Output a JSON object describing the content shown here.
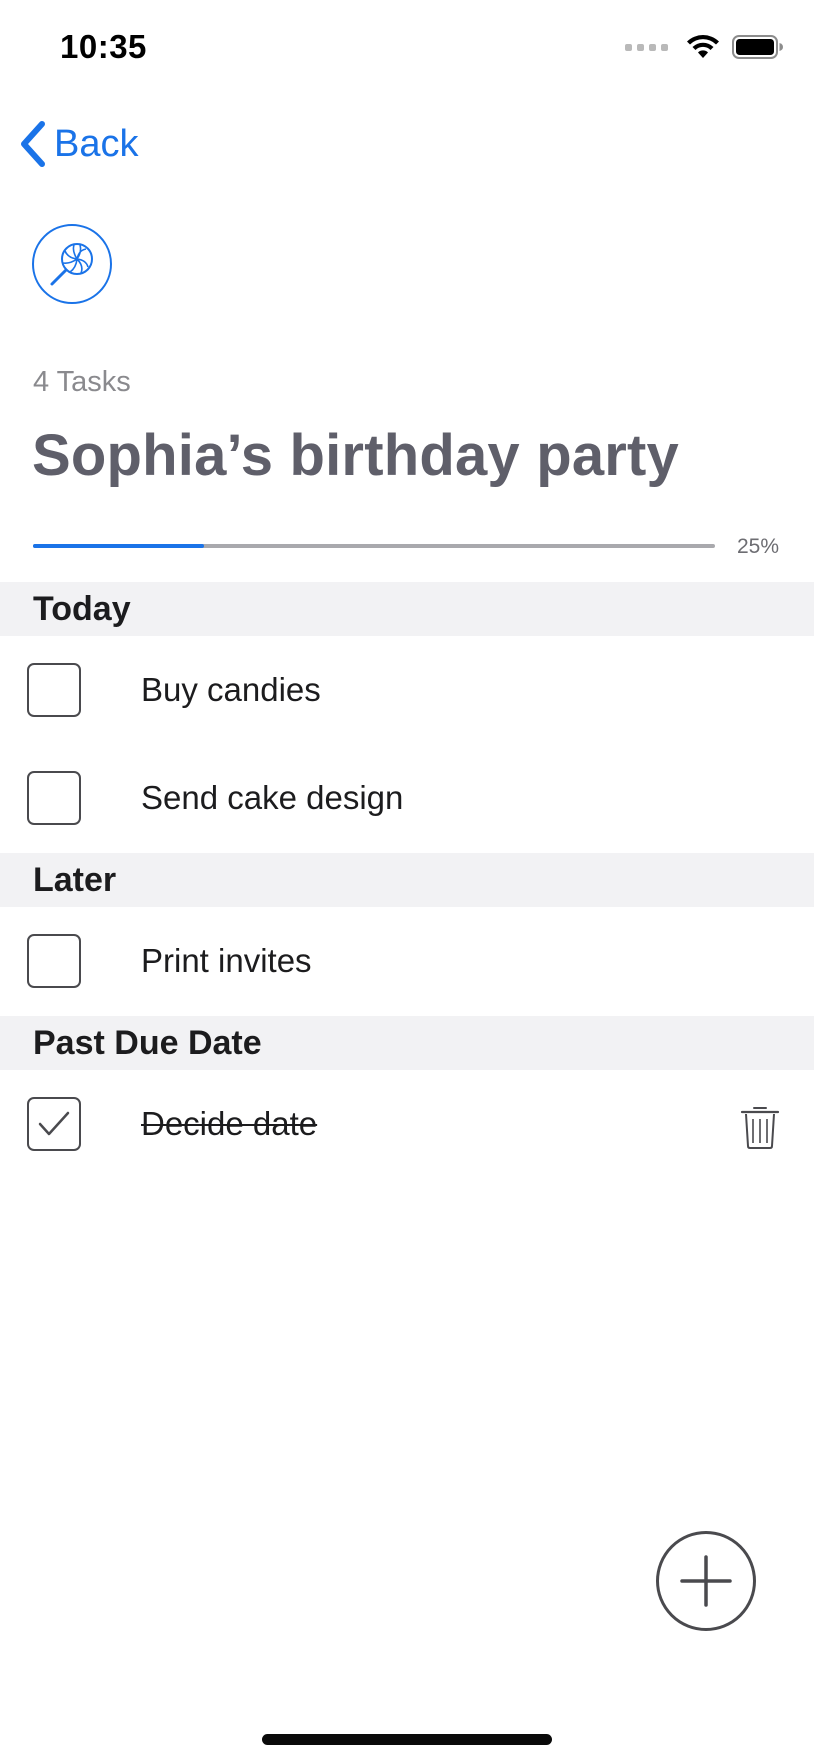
{
  "status_bar": {
    "time": "10:35",
    "icons": [
      "signal-icon",
      "wifi-icon",
      "battery-icon"
    ]
  },
  "nav": {
    "back_label": "Back"
  },
  "list": {
    "icon": "lollipop-icon",
    "task_count": "4 Tasks",
    "title": "Sophia’s birthday party",
    "progress": 0.25,
    "progress_label": "25%"
  },
  "sections": [
    {
      "title": "Today",
      "tasks": [
        {
          "label": "Buy candies",
          "done": false
        },
        {
          "label": "Send cake design",
          "done": false
        }
      ]
    },
    {
      "title": "Later",
      "tasks": [
        {
          "label": "Print invites",
          "done": false
        }
      ]
    },
    {
      "title": "Past Due Date",
      "tasks": [
        {
          "label": "Decide date",
          "done": true
        }
      ]
    }
  ],
  "actions": {
    "add": "add-task-icon",
    "delete": "trash-icon"
  },
  "colors": {
    "accent": "#1a73e8",
    "title": "#5f5f6a",
    "section_bg": "#f2f2f4"
  }
}
